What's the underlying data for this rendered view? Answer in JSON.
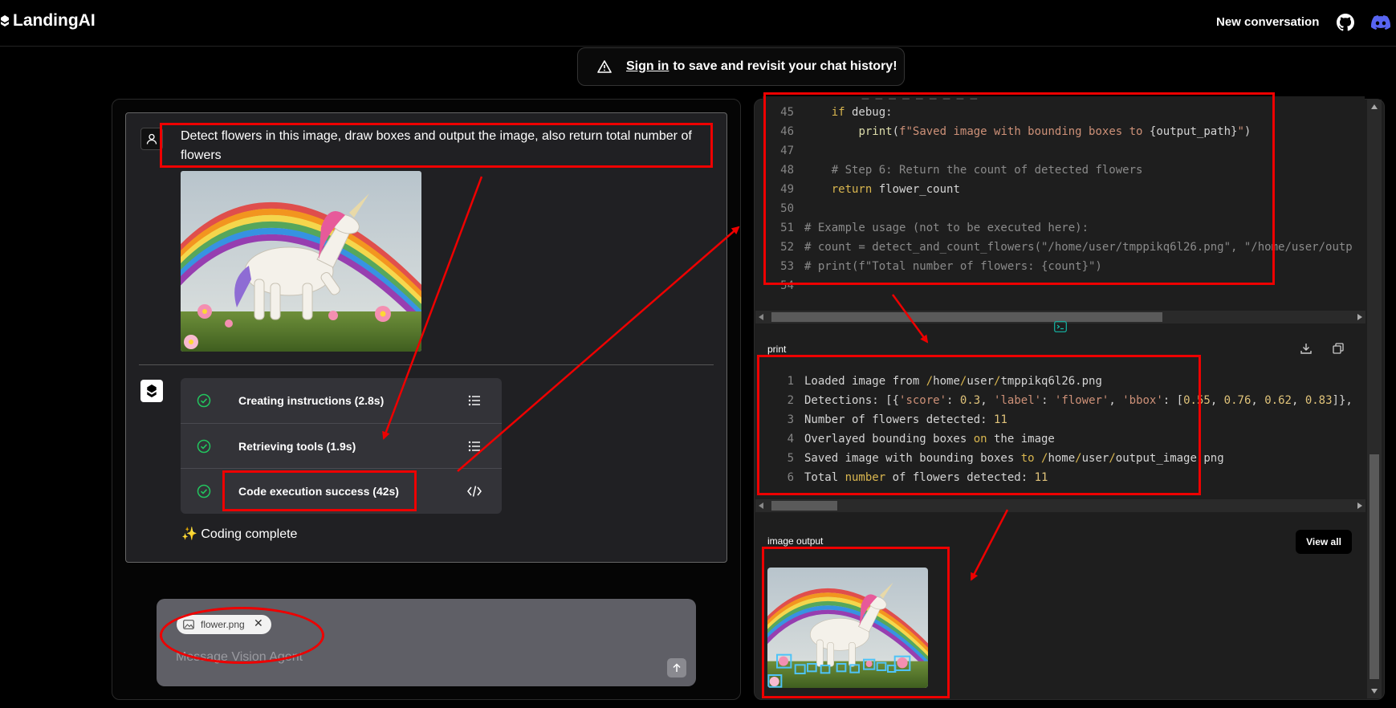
{
  "header": {
    "logo_text": "LandingAI",
    "new_conversation": "New conversation",
    "github_icon": "github-icon",
    "discord_icon": "discord-icon"
  },
  "banner": {
    "icon": "warning-icon",
    "link_text": "Sign in",
    "rest_text": "to save and revisit your chat history!"
  },
  "chat": {
    "user_message": "Detect flowers in this image, draw boxes and output the image, also return total number of flowers",
    "steps": [
      {
        "label": "Creating instructions (2.8s)",
        "status": "success",
        "action_icon": "list-icon"
      },
      {
        "label": "Retrieving tools (1.9s)",
        "status": "success",
        "action_icon": "list-icon"
      },
      {
        "label": "Code execution success (42s)",
        "status": "success",
        "action_icon": "code-icon"
      }
    ],
    "coding_complete": "✨ Coding complete"
  },
  "composer": {
    "attachment_name": "flower.png",
    "placeholder": "Message Vision Agent"
  },
  "code_panel": {
    "lines": [
      {
        "n": "45",
        "indent": "    ",
        "tokens": [
          {
            "t": "kw",
            "v": "if"
          },
          {
            "t": "",
            "v": " debug:"
          }
        ]
      },
      {
        "n": "46",
        "indent": "        ",
        "tokens": [
          {
            "t": "fn",
            "v": "print"
          },
          {
            "t": "",
            "v": "("
          },
          {
            "t": "str",
            "v": "f\"Saved image with bounding boxes to "
          },
          {
            "t": "",
            "v": "{output_path}"
          },
          {
            "t": "str",
            "v": "\""
          },
          {
            "t": "",
            "v": ")"
          }
        ]
      },
      {
        "n": "47",
        "indent": "",
        "tokens": []
      },
      {
        "n": "48",
        "indent": "    ",
        "tokens": [
          {
            "t": "cm",
            "v": "# Step 6: Return the count of detected flowers"
          }
        ]
      },
      {
        "n": "49",
        "indent": "    ",
        "tokens": [
          {
            "t": "kw",
            "v": "return"
          },
          {
            "t": "",
            "v": " flower_count"
          }
        ]
      },
      {
        "n": "50",
        "indent": "",
        "tokens": []
      },
      {
        "n": "51",
        "indent": "",
        "tokens": [
          {
            "t": "cm",
            "v": "# Example usage (not to be executed here):"
          }
        ]
      },
      {
        "n": "52",
        "indent": "",
        "tokens": [
          {
            "t": "cm",
            "v": "# count = detect_and_count_flowers(\"/home/user/tmppikq6l26.png\", \"/home/user/outp"
          }
        ]
      },
      {
        "n": "53",
        "indent": "",
        "tokens": [
          {
            "t": "cm",
            "v": "# print(f\"Total number of flowers: {count}\")"
          }
        ]
      },
      {
        "n": "54",
        "indent": "",
        "tokens": []
      }
    ]
  },
  "print_panel": {
    "label": "print",
    "lines": [
      {
        "n": "1",
        "tokens": [
          {
            "t": "",
            "v": "Loaded image from "
          },
          {
            "t": "kw",
            "v": "/"
          },
          {
            "t": "",
            "v": "home"
          },
          {
            "t": "kw",
            "v": "/"
          },
          {
            "t": "",
            "v": "user"
          },
          {
            "t": "kw",
            "v": "/"
          },
          {
            "t": "",
            "v": "tmppikq6l26.png"
          }
        ]
      },
      {
        "n": "2",
        "tokens": [
          {
            "t": "",
            "v": "Detections: [{"
          },
          {
            "t": "str",
            "v": "'score'"
          },
          {
            "t": "",
            "v": ": "
          },
          {
            "t": "num",
            "v": "0.3"
          },
          {
            "t": "",
            "v": ", "
          },
          {
            "t": "str",
            "v": "'label'"
          },
          {
            "t": "",
            "v": ": "
          },
          {
            "t": "str",
            "v": "'flower'"
          },
          {
            "t": "",
            "v": ", "
          },
          {
            "t": "str",
            "v": "'bbox'"
          },
          {
            "t": "",
            "v": ": ["
          },
          {
            "t": "num",
            "v": "0.55"
          },
          {
            "t": "",
            "v": ", "
          },
          {
            "t": "num",
            "v": "0.76"
          },
          {
            "t": "",
            "v": ", "
          },
          {
            "t": "num",
            "v": "0.62"
          },
          {
            "t": "",
            "v": ", "
          },
          {
            "t": "num",
            "v": "0.83"
          },
          {
            "t": "",
            "v": "]},"
          }
        ]
      },
      {
        "n": "3",
        "tokens": [
          {
            "t": "",
            "v": "Number of flowers detected: "
          },
          {
            "t": "num",
            "v": "11"
          }
        ]
      },
      {
        "n": "4",
        "tokens": [
          {
            "t": "",
            "v": "Overlayed bounding boxes "
          },
          {
            "t": "kw",
            "v": "on"
          },
          {
            "t": "",
            "v": " the image"
          }
        ]
      },
      {
        "n": "5",
        "tokens": [
          {
            "t": "",
            "v": "Saved image with bounding boxes "
          },
          {
            "t": "kw",
            "v": "to"
          },
          {
            "t": "",
            "v": " "
          },
          {
            "t": "kw",
            "v": "/"
          },
          {
            "t": "",
            "v": "home"
          },
          {
            "t": "kw",
            "v": "/"
          },
          {
            "t": "",
            "v": "user"
          },
          {
            "t": "kw",
            "v": "/"
          },
          {
            "t": "",
            "v": "output_image.png"
          }
        ]
      },
      {
        "n": "6",
        "tokens": [
          {
            "t": "",
            "v": "Total "
          },
          {
            "t": "kw",
            "v": "number"
          },
          {
            "t": "",
            "v": " of flowers detected: "
          },
          {
            "t": "num",
            "v": "11"
          }
        ]
      }
    ]
  },
  "image_output": {
    "label": "image output",
    "view_all": "View all"
  },
  "colors": {
    "annotation": "#e00000",
    "success_green": "#22c55e",
    "keyword": "#d9b64f",
    "string": "#ce9178"
  }
}
